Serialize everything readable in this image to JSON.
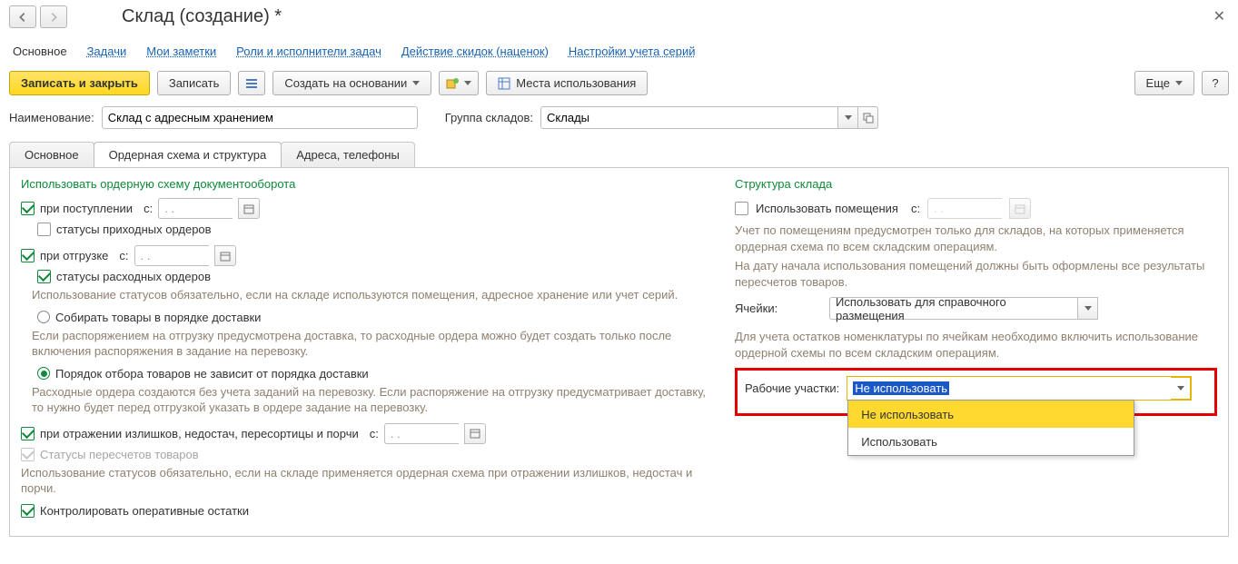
{
  "title": "Склад (создание) *",
  "nav_links": {
    "current": "Основное",
    "l1": "Задачи",
    "l2": "Мои заметки",
    "l3": "Роли и исполнители задач",
    "l4": "Действие скидок (наценок)",
    "l5": "Настройки учета серий"
  },
  "toolbar": {
    "save_close": "Записать и закрыть",
    "save": "Записать",
    "create_based": "Создать на основании",
    "usage": "Места использования",
    "more": "Еще",
    "help": "?"
  },
  "form": {
    "name_label": "Наименование:",
    "name_value": "Склад с адресным хранением",
    "group_label": "Группа складов:",
    "group_value": "Склады"
  },
  "tabs": {
    "t1": "Основное",
    "t2": "Ордерная схема и структура",
    "t3": "Адреса, телефоны"
  },
  "left": {
    "section": "Использовать ордерную схему документооборота",
    "on_receipt": "при поступлении",
    "since": "с:",
    "date_ph": "  .  .",
    "status_in": "статусы приходных ордеров",
    "on_ship": "при отгрузке",
    "status_out": "статусы расходных ордеров",
    "hint1": "Использование статусов обязательно, если на складе используются помещения, адресное хранение или учет серий.",
    "radio1": "Собирать товары в порядке доставки",
    "hint2": "Если распоряжением на отгрузку предусмотрена доставка, то расходные ордера можно будет создать только после включения распоряжения в задание на перевозку.",
    "radio2": "Порядок отбора товаров не зависит от порядка доставки",
    "hint3": "Расходные ордера создаются без учета заданий на перевозку. Если распоряжение на отгрузку предусматривает доставку, то нужно будет перед отгрузкой указать в ордере задание на перевозку.",
    "on_adjust": "при отражении излишков, недостач, пересортицы и порчи",
    "status_recount": "Статусы пересчетов товаров",
    "hint4": "Использование статусов обязательно, если на складе применяется ордерная схема при отражении излишков, недостач и порчи.",
    "control": "Контролировать оперативные остатки"
  },
  "right": {
    "section": "Структура склада",
    "use_rooms": "Использовать помещения",
    "since": "с:",
    "date_ph": "  .  .",
    "hint1": "Учет по помещениям предусмотрен только для складов, на которых применяется ордерная схема по всем складским операциям.",
    "hint1b": "На дату начала использования помещений должны быть оформлены все результаты пересчетов товаров.",
    "cells_label": "Ячейки:",
    "cells_value": "Использовать для справочного размещения",
    "hint2": "Для учета остатков номенклатуры по ячейкам необходимо включить использование ордерной схемы по всем складским операциям.",
    "work_label": "Рабочие участки:",
    "work_value": "Не использовать",
    "dd_opt1": "Не использовать",
    "dd_opt2": "Использовать"
  }
}
